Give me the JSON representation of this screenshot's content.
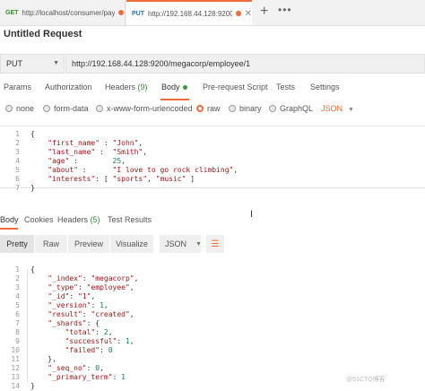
{
  "tabs": [
    {
      "method": "GET",
      "url": "http://localhost/consumer/pay..."
    },
    {
      "method": "PUT",
      "url": "http://192.168.44.128:9200/me..."
    }
  ],
  "tab_close": "✕",
  "new_tab": "+",
  "more": "•••",
  "request_title": "Untitled Request",
  "request": {
    "method": "PUT",
    "url": "http://192.168.44.128:9200/megacorp/employee/1"
  },
  "request_tabs": {
    "params": "Params",
    "authorization": "Authorization",
    "headers": "Headers",
    "headers_count": "(9)",
    "body": "Body",
    "prerequest": "Pre-request Script",
    "tests": "Tests",
    "settings": "Settings"
  },
  "body_types": [
    "none",
    "form-data",
    "x-www-form-urlencoded",
    "raw",
    "binary",
    "GraphQL"
  ],
  "body_format": "JSON",
  "request_body": [
    {
      "n": "1",
      "t": "{"
    },
    {
      "n": "2",
      "t": "    \"first_name\" : \"John\","
    },
    {
      "n": "3",
      "t": "    \"last_name\" :  \"Smith\","
    },
    {
      "n": "4",
      "t": "    \"age\" :        25,"
    },
    {
      "n": "5",
      "t": "    \"about\" :      \"I love to go rock climbing\","
    },
    {
      "n": "6",
      "t": "    \"interests\": [ \"sports\", \"music\" ]"
    },
    {
      "n": "7",
      "t": "}"
    }
  ],
  "response_tabs": {
    "body": "Body",
    "cookies": "Cookies",
    "headers": "Headers",
    "headers_count": "(5)",
    "test_results": "Test Results"
  },
  "views": [
    "Pretty",
    "Raw",
    "Preview",
    "Visualize"
  ],
  "response_format": "JSON",
  "response_body": [
    {
      "n": "1",
      "t": "{"
    },
    {
      "n": "2",
      "t": "    \"_index\": \"megacorp\","
    },
    {
      "n": "3",
      "t": "    \"_type\": \"employee\","
    },
    {
      "n": "4",
      "t": "    \"_id\": \"1\","
    },
    {
      "n": "5",
      "t": "    \"_version\": 1,"
    },
    {
      "n": "6",
      "t": "    \"result\": \"created\","
    },
    {
      "n": "7",
      "t": "    \"_shards\": {"
    },
    {
      "n": "8",
      "t": "        \"total\": 2,"
    },
    {
      "n": "9",
      "t": "        \"successful\": 1,"
    },
    {
      "n": "10",
      "t": "        \"failed\": 0"
    },
    {
      "n": "11",
      "t": "    },"
    },
    {
      "n": "12",
      "t": "    \"_seq_no\": 0,"
    },
    {
      "n": "13",
      "t": "    \"_primary_term\": 1"
    },
    {
      "n": "14",
      "t": "}"
    }
  ],
  "watermark": "@51CTO博客",
  "colors": {
    "accent": "#f26b3a",
    "success": "#3a8a3a",
    "string": "#a31515",
    "number": "#098658"
  }
}
